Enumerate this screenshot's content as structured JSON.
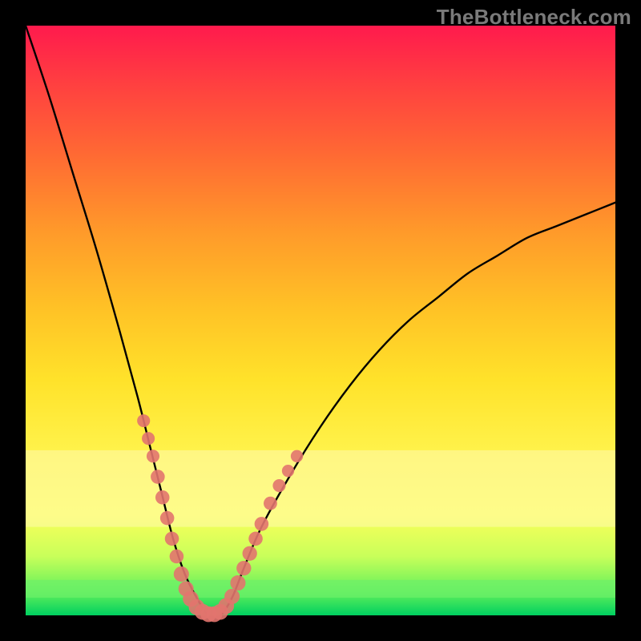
{
  "watermark": "TheBottleneck.com",
  "colors": {
    "frame": "#000000",
    "curve": "#000000",
    "marker_fill": "#e2746e",
    "marker_stroke": "#c85c56"
  },
  "chart_data": {
    "type": "line",
    "title": "",
    "xlabel": "",
    "ylabel": "",
    "xlim": [
      0,
      100
    ],
    "ylim": [
      0,
      100
    ],
    "series": [
      {
        "name": "bottleneck-curve",
        "x": [
          0,
          4,
          8,
          12,
          16,
          19,
          21,
          23,
          25,
          27,
          29,
          31,
          33,
          35,
          37,
          40,
          45,
          50,
          55,
          60,
          65,
          70,
          75,
          80,
          85,
          90,
          95,
          100
        ],
        "y": [
          100,
          88,
          75,
          62,
          48,
          37,
          29,
          21,
          13,
          7,
          3,
          0,
          0,
          3,
          8,
          15,
          24,
          32,
          39,
          45,
          50,
          54,
          58,
          61,
          64,
          66,
          68,
          70
        ]
      }
    ],
    "markers": [
      {
        "x": 20.0,
        "y": 33.0,
        "r": 1.1
      },
      {
        "x": 20.8,
        "y": 30.0,
        "r": 1.1
      },
      {
        "x": 21.6,
        "y": 27.0,
        "r": 1.1
      },
      {
        "x": 22.4,
        "y": 23.5,
        "r": 1.3
      },
      {
        "x": 23.2,
        "y": 20.0,
        "r": 1.3
      },
      {
        "x": 24.0,
        "y": 16.5,
        "r": 1.3
      },
      {
        "x": 24.8,
        "y": 13.0,
        "r": 1.3
      },
      {
        "x": 25.6,
        "y": 10.0,
        "r": 1.3
      },
      {
        "x": 26.4,
        "y": 7.0,
        "r": 1.5
      },
      {
        "x": 27.2,
        "y": 4.5,
        "r": 1.5
      },
      {
        "x": 28.0,
        "y": 2.8,
        "r": 1.6
      },
      {
        "x": 29.0,
        "y": 1.4,
        "r": 1.6
      },
      {
        "x": 30.0,
        "y": 0.6,
        "r": 1.6
      },
      {
        "x": 31.0,
        "y": 0.2,
        "r": 1.6
      },
      {
        "x": 32.0,
        "y": 0.2,
        "r": 1.6
      },
      {
        "x": 33.0,
        "y": 0.6,
        "r": 1.6
      },
      {
        "x": 34.0,
        "y": 1.6,
        "r": 1.6
      },
      {
        "x": 35.0,
        "y": 3.2,
        "r": 1.5
      },
      {
        "x": 36.0,
        "y": 5.5,
        "r": 1.5
      },
      {
        "x": 37.0,
        "y": 8.0,
        "r": 1.4
      },
      {
        "x": 38.0,
        "y": 10.5,
        "r": 1.4
      },
      {
        "x": 39.0,
        "y": 13.0,
        "r": 1.3
      },
      {
        "x": 40.0,
        "y": 15.5,
        "r": 1.3
      },
      {
        "x": 41.5,
        "y": 19.0,
        "r": 1.2
      },
      {
        "x": 43.0,
        "y": 22.0,
        "r": 1.1
      },
      {
        "x": 44.5,
        "y": 24.5,
        "r": 1.0
      },
      {
        "x": 46.0,
        "y": 27.0,
        "r": 1.0
      }
    ],
    "highlight_bands": [
      {
        "y0": 72,
        "y1": 85,
        "color": "#fff9b0",
        "opacity": 0.55
      },
      {
        "y0": 94,
        "y1": 97,
        "color": "#6cf06a",
        "opacity": 0.7
      }
    ]
  }
}
